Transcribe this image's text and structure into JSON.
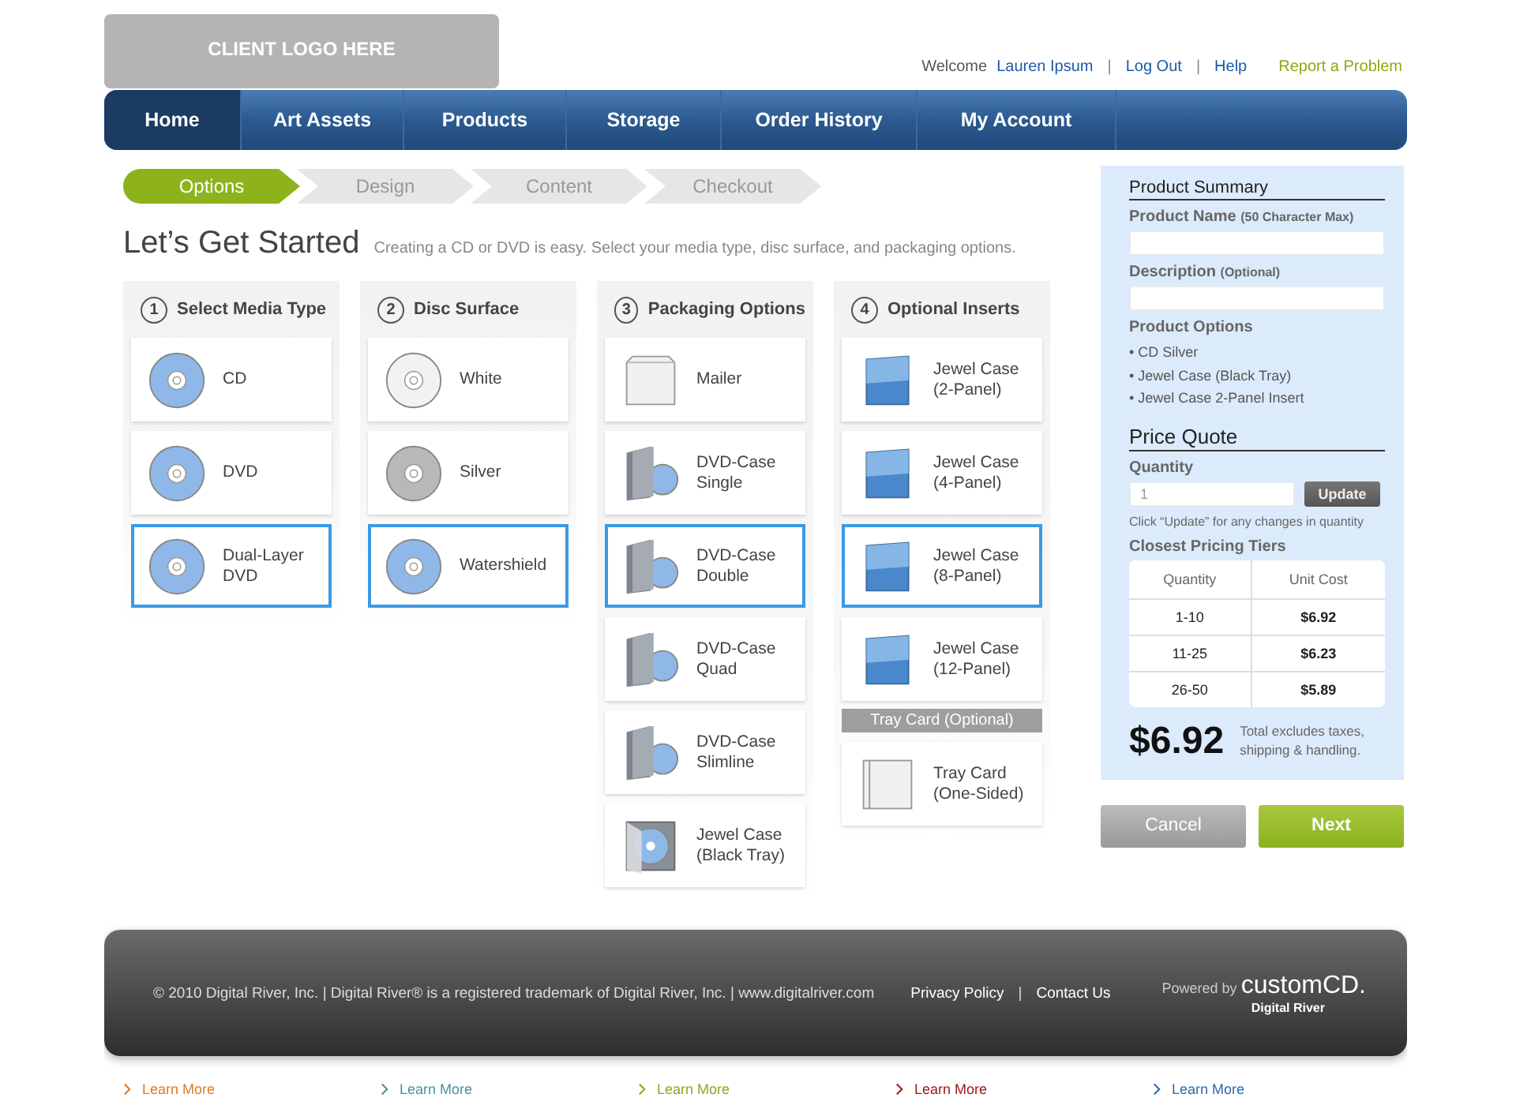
{
  "header": {
    "logo": "CLIENT LOGO HERE",
    "welcome": "Welcome",
    "user": "Lauren Ipsum",
    "logout": "Log Out",
    "help": "Help",
    "report": "Report a Problem",
    "separators": [
      "|",
      "|"
    ]
  },
  "nav": [
    {
      "label": "Home",
      "selected": true
    },
    {
      "label": "Art Assets",
      "selected": false
    },
    {
      "label": "Products",
      "selected": false
    },
    {
      "label": "Storage",
      "selected": false
    },
    {
      "label": "Order History",
      "selected": false
    },
    {
      "label": "My Account",
      "selected": false
    }
  ],
  "steps": [
    {
      "label": "Options",
      "selected": true
    },
    {
      "label": "Design",
      "selected": false
    },
    {
      "label": "Content",
      "selected": false
    },
    {
      "label": "Checkout",
      "selected": false
    }
  ],
  "title": "Let’s Get Started",
  "subtitle": "Creating a CD or DVD is easy. Select your media type, disc surface, and packaging options.",
  "columns": [
    {
      "number": "1",
      "heading": "Select Media Type",
      "options": [
        {
          "label": "CD",
          "kind": "disc",
          "color": "#8fb8e8",
          "selected": false
        },
        {
          "label": "DVD",
          "kind": "disc",
          "color": "#8fb8e8",
          "selected": false
        },
        {
          "label": "Dual-Layer DVD",
          "kind": "disc",
          "color": "#8fb8e8",
          "selected": true
        }
      ]
    },
    {
      "number": "2",
      "heading": "Disc Surface",
      "options": [
        {
          "label": "White",
          "kind": "disc",
          "color": "#f2f2f2",
          "selected": false
        },
        {
          "label": "Silver",
          "kind": "disc",
          "color": "#b8b8b8",
          "selected": false
        },
        {
          "label": "Watershield",
          "kind": "disc",
          "color": "#8fb8e8",
          "selected": true
        }
      ]
    },
    {
      "number": "3",
      "heading": "Packaging Options",
      "options": [
        {
          "label": "Mailer",
          "kind": "mailer",
          "selected": false
        },
        {
          "label": "DVD-Case Single",
          "kind": "case",
          "selected": false
        },
        {
          "label": "DVD-Case Double",
          "kind": "case",
          "selected": true
        },
        {
          "label": "DVD-Case Quad",
          "kind": "case",
          "selected": false
        },
        {
          "label": "DVD-Case Slimline",
          "kind": "case",
          "selected": false
        },
        {
          "label": "Jewel Case (Black Tray)",
          "kind": "jewel",
          "selected": false
        }
      ]
    },
    {
      "number": "4",
      "heading": "Optional Inserts",
      "options": [
        {
          "label": "Jewel Case (2-Panel)",
          "kind": "booklet",
          "selected": false
        },
        {
          "label": "Jewel Case (4-Panel)",
          "kind": "booklet",
          "selected": false
        },
        {
          "label": "Jewel Case (8-Panel)",
          "kind": "booklet",
          "selected": true
        },
        {
          "label": "Jewel Case (12-Panel)",
          "kind": "booklet",
          "selected": false
        },
        {
          "label": "Tray Card (Optional)",
          "kind": "divider"
        },
        {
          "label": "Tray Card (One-Sided)",
          "kind": "traycard",
          "selected": false
        }
      ]
    }
  ],
  "summary": {
    "heading": "Product Summary",
    "name_label": "Product Name",
    "name_hint": "(50 Character Max)",
    "description_label": "Description",
    "description_hint": "(Optional)",
    "options_label": "Product Options",
    "options": [
      "• CD Silver",
      "• Jewel Case (Black Tray)",
      "• Jewel Case 2-Panel Insert"
    ],
    "quote_heading": "Price Quote",
    "quantity_label": "Quantity",
    "quantity": "1",
    "update": "Update",
    "update_note": "Click “Update” for any changes in quantity",
    "tiers_label": "Closest Pricing Tiers",
    "tier_columns": [
      "Quantity",
      "Unit Cost"
    ],
    "tiers": [
      {
        "quantity": "1-10",
        "cost": "$6.92"
      },
      {
        "quantity": "11-25",
        "cost": "$6.23"
      },
      {
        "quantity": "26-50",
        "cost": "$5.89"
      }
    ],
    "total": "$6.92",
    "total_note": "Total excludes taxes, shipping & handling."
  },
  "buttons": {
    "cancel": "Cancel",
    "next": "Next"
  },
  "footer": {
    "copyright": "© 2010 Digital River, Inc. | Digital River® is a registered trademark of Digital River, Inc. | www.digitalriver.com",
    "privacy": "Privacy Policy",
    "separator": "|",
    "contact": "Contact Us",
    "powered": "Powered by",
    "brand": "customCD.",
    "brand_sub": "Digital River"
  },
  "learn_more": [
    {
      "label": "Learn More",
      "color": "#e07a20"
    },
    {
      "label": "Learn More",
      "color": "#4a8fa0"
    },
    {
      "label": "Learn More",
      "color": "#8aa820"
    },
    {
      "label": "Learn More",
      "color": "#a01818"
    },
    {
      "label": "Learn More",
      "color": "#2a6ab0"
    }
  ]
}
